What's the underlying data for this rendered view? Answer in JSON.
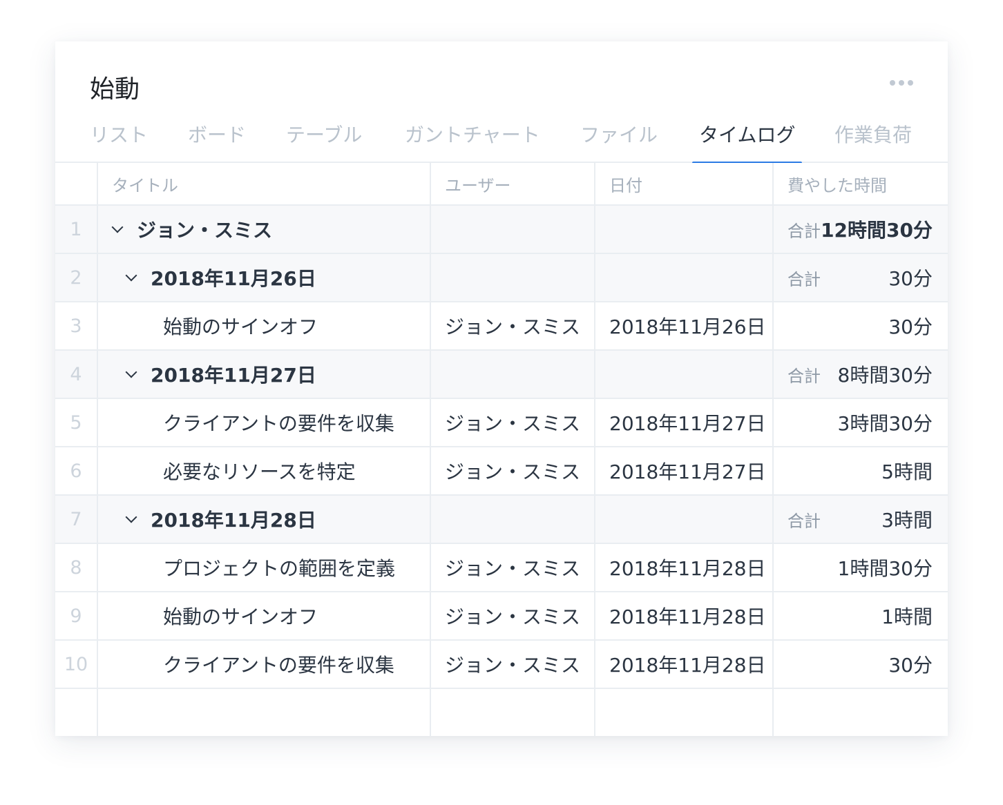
{
  "project": {
    "title": "始動"
  },
  "tabs": [
    {
      "label": "リスト",
      "active": false
    },
    {
      "label": "ボード",
      "active": false
    },
    {
      "label": "テーブル",
      "active": false
    },
    {
      "label": "ガントチャート",
      "active": false
    },
    {
      "label": "ファイル",
      "active": false
    },
    {
      "label": "タイムログ",
      "active": true
    },
    {
      "label": "作業負荷",
      "active": false
    }
  ],
  "table": {
    "columns": [
      "タイトル",
      "ユーザー",
      "日付",
      "費やした時間"
    ],
    "total_label": "合計",
    "rows": [
      {
        "num": "1",
        "type": "group",
        "level": 0,
        "title": "ジョン・スミス",
        "user": "",
        "date": "",
        "time": "12時間30分"
      },
      {
        "num": "2",
        "type": "group",
        "level": 1,
        "title": "2018年11月26日",
        "user": "",
        "date": "",
        "time": "30分"
      },
      {
        "num": "3",
        "type": "entry",
        "level": 2,
        "title": "始動のサインオフ",
        "user": "ジョン・スミス",
        "date": "2018年11月26日",
        "time": "30分"
      },
      {
        "num": "4",
        "type": "group",
        "level": 1,
        "title": "2018年11月27日",
        "user": "",
        "date": "",
        "time": "8時間30分"
      },
      {
        "num": "5",
        "type": "entry",
        "level": 2,
        "title": "クライアントの要件を収集",
        "user": "ジョン・スミス",
        "date": "2018年11月27日",
        "time": "3時間30分"
      },
      {
        "num": "6",
        "type": "entry",
        "level": 2,
        "title": "必要なリソースを特定",
        "user": "ジョン・スミス",
        "date": "2018年11月27日",
        "time": "5時間"
      },
      {
        "num": "7",
        "type": "group",
        "level": 1,
        "title": "2018年11月28日",
        "user": "",
        "date": "",
        "time": "3時間"
      },
      {
        "num": "8",
        "type": "entry",
        "level": 2,
        "title": "プロジェクトの範囲を定義",
        "user": "ジョン・スミス",
        "date": "2018年11月28日",
        "time": "1時間30分"
      },
      {
        "num": "9",
        "type": "entry",
        "level": 2,
        "title": "始動のサインオフ",
        "user": "ジョン・スミス",
        "date": "2018年11月28日",
        "time": "1時間"
      },
      {
        "num": "10",
        "type": "entry",
        "level": 2,
        "title": "クライアントの要件を収集",
        "user": "ジョン・スミス",
        "date": "2018年11月28日",
        "time": "30分"
      }
    ]
  },
  "icons": {
    "more": "more-horizontal-icon",
    "expand": "chevron-down-icon"
  },
  "colors": {
    "accent": "#2a7ae4",
    "text": "#2b3542",
    "muted": "#b9c2cc",
    "group_bg": "#f7f8fa",
    "border": "#e9edf1"
  }
}
